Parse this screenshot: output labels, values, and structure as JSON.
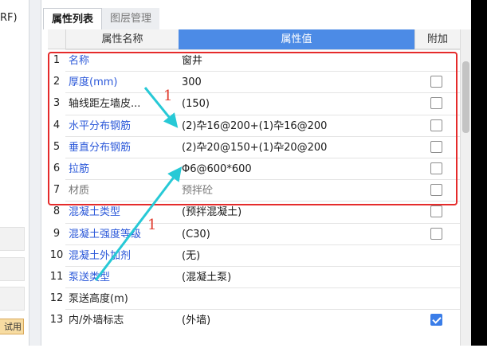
{
  "left_panel": {
    "text": "RF)",
    "button_label": "试用"
  },
  "tabs": [
    {
      "label": "属性列表",
      "active": true
    },
    {
      "label": "图层管理",
      "active": false
    }
  ],
  "table": {
    "headers": {
      "name": "属性名称",
      "value": "属性值",
      "extra": "附加"
    },
    "rows": [
      {
        "num": "1",
        "name": "名称",
        "value": "窗井",
        "checkbox": "none"
      },
      {
        "num": "2",
        "name": "厚度(mm)",
        "value": "300",
        "checkbox": "unchecked"
      },
      {
        "num": "3",
        "name": "轴线距左墙皮...",
        "value": "(150)",
        "checkbox": "unchecked"
      },
      {
        "num": "4",
        "name": "水平分布钢筋",
        "value": "(2)卆16@200+(1)卆16@200",
        "checkbox": "unchecked"
      },
      {
        "num": "5",
        "name": "垂直分布钢筋",
        "value": "(2)卆20@150+(1)卆20@200",
        "checkbox": "unchecked"
      },
      {
        "num": "6",
        "name": "拉筋",
        "value": "Φ6@600*600",
        "checkbox": "unchecked"
      },
      {
        "num": "7",
        "name": "材质",
        "value": "预拌砼",
        "checkbox": "unchecked"
      },
      {
        "num": "8",
        "name": "混凝土类型",
        "value": "(预拌混凝土)",
        "checkbox": "unchecked"
      },
      {
        "num": "9",
        "name": "混凝土强度等级",
        "value": "(C30)",
        "checkbox": "unchecked"
      },
      {
        "num": "10",
        "name": "混凝土外加剂",
        "value": "(无)",
        "checkbox": "none"
      },
      {
        "num": "11",
        "name": "泵送类型",
        "value": "(混凝土泵)",
        "checkbox": "none"
      },
      {
        "num": "12",
        "name": "泵送高度(m)",
        "value": "",
        "checkbox": "none"
      },
      {
        "num": "13",
        "name": "内/外墙标志",
        "value": "(外墙)",
        "checkbox": "checked"
      }
    ]
  },
  "annotations": {
    "label_top": "1",
    "label_bottom": "1"
  },
  "colors": {
    "accent": "#4c8be6",
    "link_blue": "#2b58d9",
    "annotation_red": "#e52b2b",
    "arrow_cyan": "#27c9d6"
  }
}
